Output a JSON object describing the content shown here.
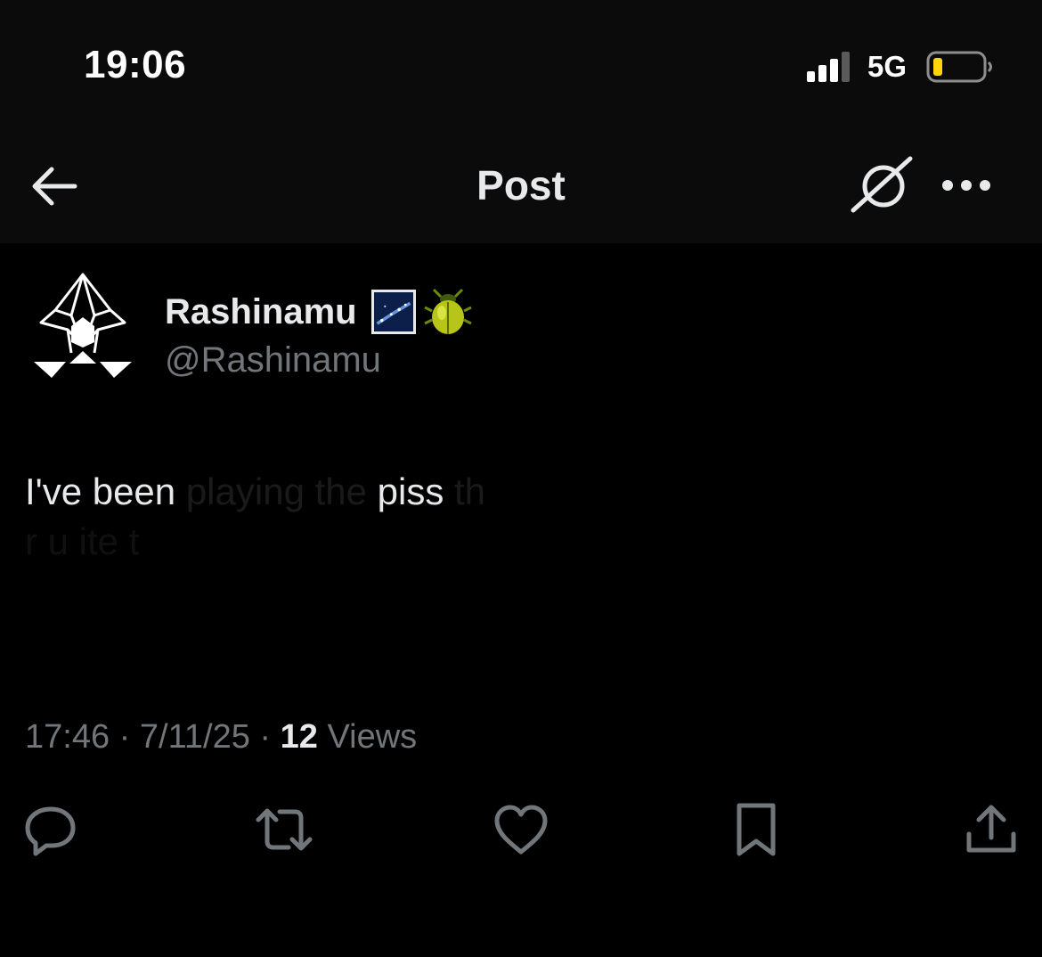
{
  "status_bar": {
    "time": "19:06",
    "network": "5G",
    "signal_icon": "signal-bars-icon",
    "battery_icon": "battery-low-icon",
    "battery_color": "#ffd60a"
  },
  "nav": {
    "title": "Post",
    "back_icon": "back-arrow-icon",
    "grok_icon": "grok-icon",
    "more_icon": "more-dots-icon"
  },
  "author": {
    "display_name": "Rashinamu",
    "handle": "@Rashinamu",
    "avatar_icon": "geometric-logo-avatar",
    "emoji": [
      "milky-way-icon",
      "beetle-icon"
    ]
  },
  "post": {
    "text_visible_1": "I've been ",
    "text_faded_1": "playing the",
    "text_visible_2": " piss",
    "text_faded_2": " th",
    "text_line2_faded": "r  u  ite     t"
  },
  "meta": {
    "time": "17:46",
    "sep1": " · ",
    "date": "7/11/25",
    "sep2": " · ",
    "views_count": "12",
    "views_label": " Views"
  },
  "actions": [
    "reply-icon",
    "repost-icon",
    "like-icon",
    "bookmark-icon",
    "share-icon"
  ],
  "colors": {
    "background": "#000000",
    "header": "#0b0b0b",
    "text_primary": "#e7e9ea",
    "text_secondary": "#71767b"
  }
}
